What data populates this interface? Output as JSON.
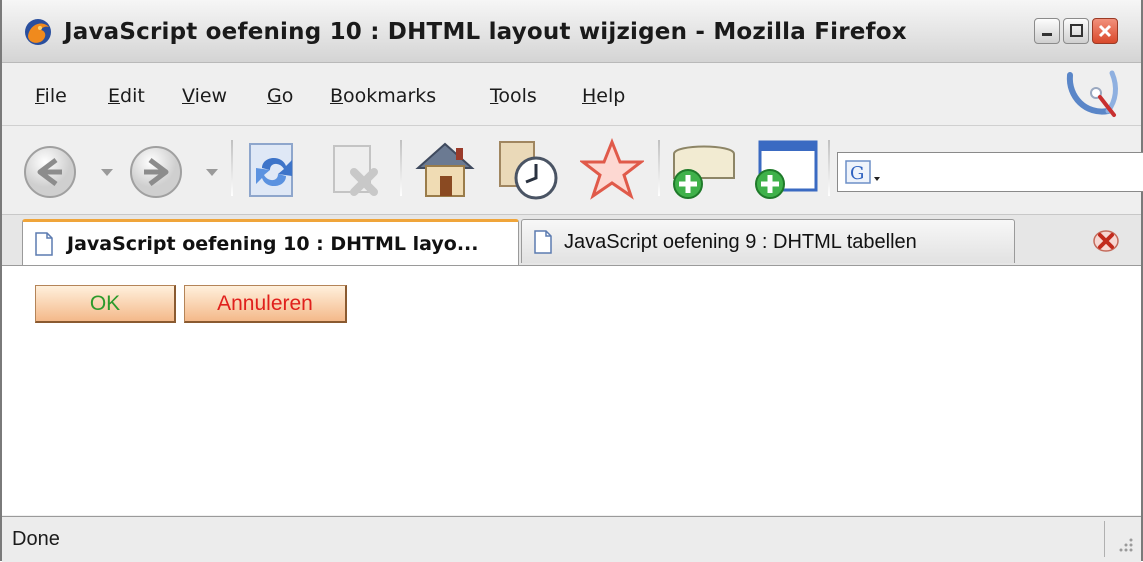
{
  "window": {
    "title": "JavaScript oefening 10 : DHTML layout wijzigen - Mozilla Firefox"
  },
  "menu": {
    "items": [
      {
        "first": "F",
        "rest": "ile"
      },
      {
        "first": "E",
        "rest": "dit"
      },
      {
        "first": "V",
        "rest": "iew"
      },
      {
        "first": "G",
        "rest": "o"
      },
      {
        "first": "B",
        "rest": "ookmarks"
      },
      {
        "first": "T",
        "rest": "ools"
      },
      {
        "first": "H",
        "rest": "elp"
      }
    ]
  },
  "toolbar": {
    "icons": [
      "back-icon",
      "forward-icon",
      "reload-icon",
      "stop-icon",
      "home-icon",
      "history-icon",
      "bookmark-star-icon",
      "new-tab-icon",
      "new-window-icon",
      "google-search-icon"
    ]
  },
  "tabs": [
    {
      "label": "JavaScript oefening 10 : DHTML layo...",
      "active": true
    },
    {
      "label": "JavaScript oefening 9 : DHTML tabellen",
      "active": false
    }
  ],
  "content": {
    "ok_label": "OK",
    "cancel_label": "Annuleren",
    "ok_color": "#2c9a2c",
    "cancel_color": "#e0201c"
  },
  "status": {
    "text": "Done"
  }
}
